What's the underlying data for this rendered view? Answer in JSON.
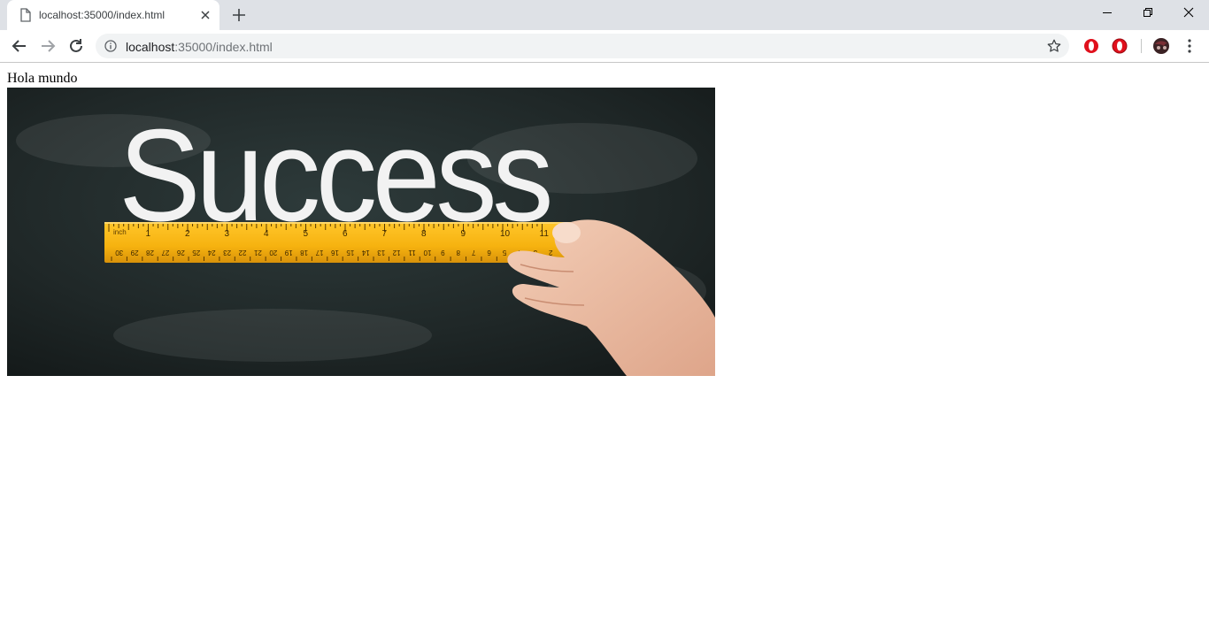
{
  "browser": {
    "tab": {
      "title": "localhost:35000/index.html",
      "icon": "document-icon"
    },
    "address_bar": {
      "host": "localhost",
      "rest": ":35000/index.html"
    },
    "colors": {
      "tabstrip": "#dee1e6",
      "omnibox": "#f1f3f4",
      "opera_red": "#e0101c",
      "ruler_yellow": "#f6b20f"
    }
  },
  "page": {
    "greeting": "Hola mundo",
    "image": {
      "headline": "Success",
      "ruler_unit_label": "inch",
      "inch_marks": [
        "1",
        "2",
        "3",
        "4",
        "5",
        "6",
        "7",
        "8",
        "9",
        "10",
        "11"
      ],
      "cm_marks": [
        "30",
        "29",
        "28",
        "27",
        "26",
        "25",
        "24",
        "23",
        "22",
        "21",
        "20",
        "19",
        "18",
        "17",
        "16",
        "15",
        "14",
        "13",
        "12",
        "11",
        "10",
        "9",
        "8",
        "7",
        "6",
        "5",
        "4",
        "3",
        "2"
      ]
    }
  }
}
